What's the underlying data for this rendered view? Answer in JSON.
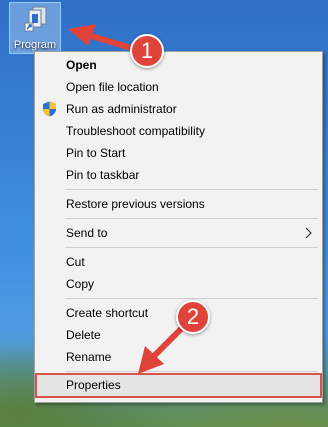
{
  "desktop": {
    "icon_label": "Program",
    "icon_name": "program-shortcut-icon"
  },
  "menu": {
    "items": [
      {
        "label": "Open",
        "bold": true
      },
      {
        "label": "Open file location"
      },
      {
        "label": "Run as administrator",
        "icon": "uac-shield-icon"
      },
      {
        "label": "Troubleshoot compatibility"
      },
      {
        "label": "Pin to Start"
      },
      {
        "label": "Pin to taskbar"
      },
      {
        "label": "Restore previous versions"
      },
      {
        "label": "Send to",
        "submenu": true
      },
      {
        "label": "Cut"
      },
      {
        "label": "Copy"
      },
      {
        "label": "Create shortcut"
      },
      {
        "label": "Delete"
      },
      {
        "label": "Rename"
      },
      {
        "label": "Properties",
        "highlighted": true
      }
    ]
  },
  "annotations": {
    "badge_1": "1",
    "badge_2": "2",
    "color": "#e0433a"
  }
}
